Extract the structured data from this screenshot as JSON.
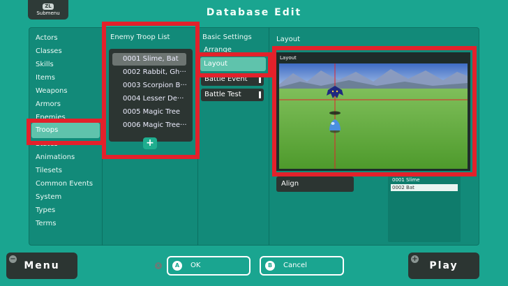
{
  "header": {
    "submenu_key": "ZL",
    "submenu_label": "Submenu",
    "title": "Database Edit"
  },
  "categories": {
    "items": [
      "Actors",
      "Classes",
      "Skills",
      "Items",
      "Weapons",
      "Armors",
      "Enemies",
      "Troops",
      "States",
      "Animations",
      "Tilesets",
      "Common Events",
      "System",
      "Types",
      "Terms"
    ],
    "selected": "Troops"
  },
  "troop_list": {
    "heading": "Enemy Troop List",
    "items": [
      "0001 Slime, Bat",
      "0002 Rabbit, Gh···",
      "0003 Scorpion B···",
      "0004 Lesser De···",
      "0005 Magic Tree",
      "0006 Magic Tree···"
    ],
    "add_label": "+"
  },
  "settings": {
    "heading": "Basic Settings",
    "arrange_label": "Arrange",
    "layout_label": "Layout",
    "battle_event_label": "Battle Event",
    "battle_test_label": "Battle Test"
  },
  "layout_panel": {
    "heading": "Layout",
    "preview_label": "Layout",
    "align_label": "Align",
    "enemies": [
      "0001 Slime",
      "0002 Bat"
    ],
    "selected_enemy": "0002 Bat"
  },
  "footer": {
    "menu_label": "Menu",
    "play_label": "Play",
    "x_key": "X",
    "ok_key": "A",
    "ok_label": "OK",
    "cancel_key": "B",
    "cancel_label": "Cancel"
  },
  "colors": {
    "background": "#1aa590",
    "highlight": "#e3212b",
    "selected_item": "#5fc3ac",
    "dark_panel": "#2c3532"
  }
}
